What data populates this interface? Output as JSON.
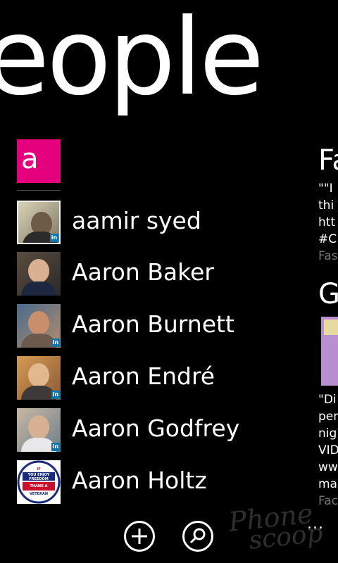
{
  "header": {
    "title": "eople"
  },
  "group": {
    "letter": "a"
  },
  "contacts": [
    {
      "name": "aamir syed",
      "badge": "in"
    },
    {
      "name": "Aaron Baker"
    },
    {
      "name": "Aaron Burnett",
      "badge": "in"
    },
    {
      "name": "Aaron Endré",
      "badge": "in"
    },
    {
      "name": "Aaron Godfrey",
      "badge": "in"
    },
    {
      "name": "Aaron Holtz",
      "avatar_text": [
        "IF",
        "YOU ENJOY",
        "FREEDOM",
        "THANK A",
        "VETERAN"
      ]
    }
  ],
  "whats_new": {
    "item1": {
      "heading": "Fa",
      "lines": [
        "\"\"I",
        "thi",
        "htt",
        "#C"
      ],
      "source": "Fas"
    },
    "item2": {
      "heading": "G",
      "lines": [
        "\"Di",
        "per",
        "nig",
        "VID",
        "ww",
        "ma"
      ],
      "source": "Fac"
    }
  },
  "appbar": {
    "add_label": "+",
    "more_label": "..."
  },
  "watermark": {
    "line1": "Phone",
    "line2": "scoop"
  },
  "colors": {
    "accent": "#e5007e",
    "linkedin": "#0e76a8"
  }
}
